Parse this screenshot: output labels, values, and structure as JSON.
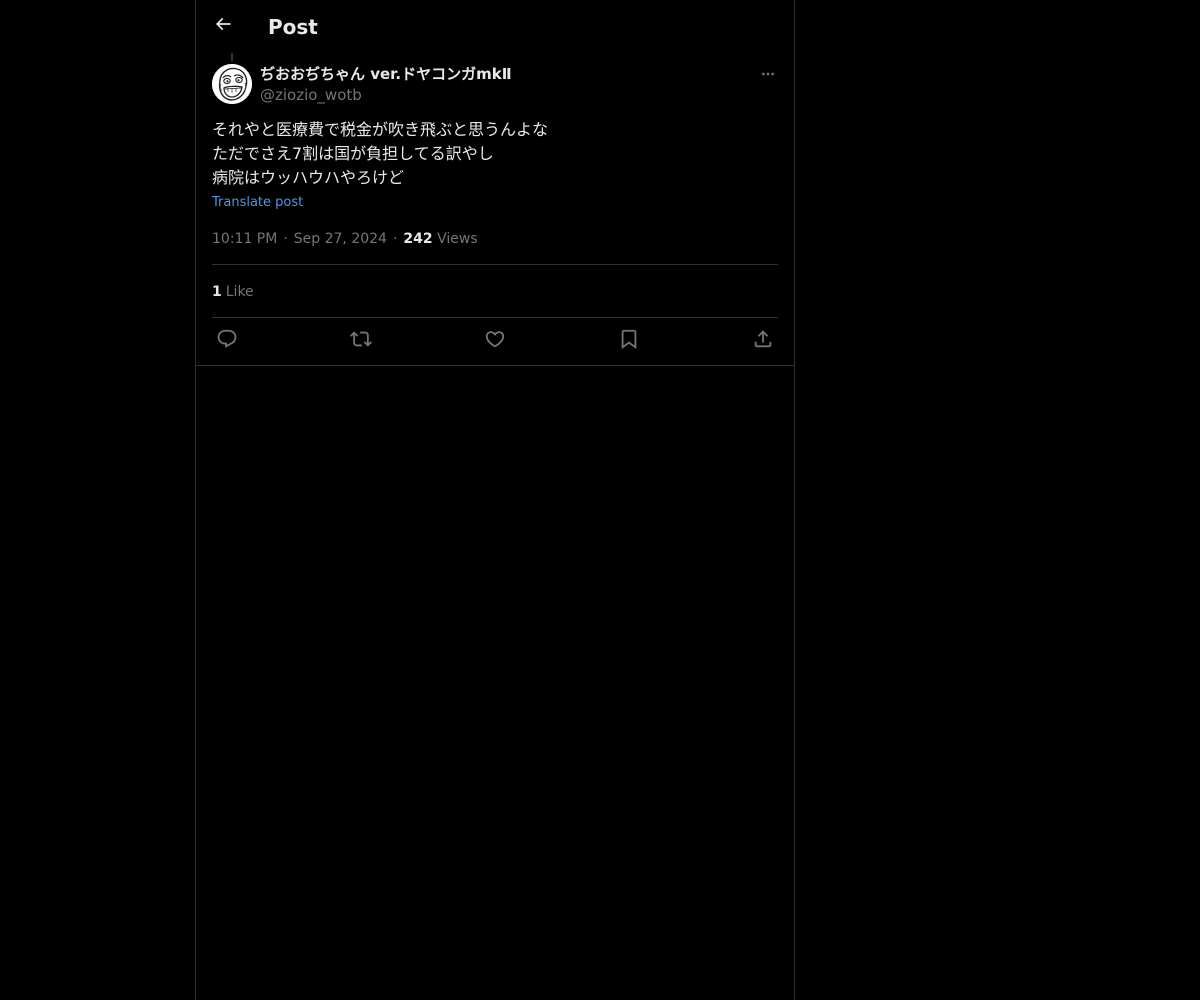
{
  "header": {
    "back_icon": "arrow-left-icon",
    "title": "Post"
  },
  "author": {
    "display_name": "ぢおおぢちゃん ver.ドヤコンガmkⅡ",
    "handle": "@ziozio_wotb",
    "avatar_icon": "avatar-face-icon"
  },
  "post": {
    "lines": [
      "それやと医療費で税金が吹き飛ぶと思うんよな",
      "ただでさえ7割は国が負担してる訳やし",
      "病院はウッハウハやろけど"
    ],
    "translate_label": "Translate post",
    "time": "10:11 PM",
    "date": "Sep 27, 2024",
    "views_count": "242",
    "views_label": "Views",
    "likes_count": "1",
    "likes_label": "Like"
  },
  "actions": {
    "reply_icon": "reply-icon",
    "repost_icon": "repost-icon",
    "like_icon": "heart-icon",
    "bookmark_icon": "bookmark-icon",
    "share_icon": "share-icon",
    "more_icon": "more-icon"
  },
  "colors": {
    "background": "#000000",
    "text_primary": "#e7e9ea",
    "text_secondary": "#71767b",
    "accent": "#4a99e9",
    "border": "#2f3336"
  }
}
